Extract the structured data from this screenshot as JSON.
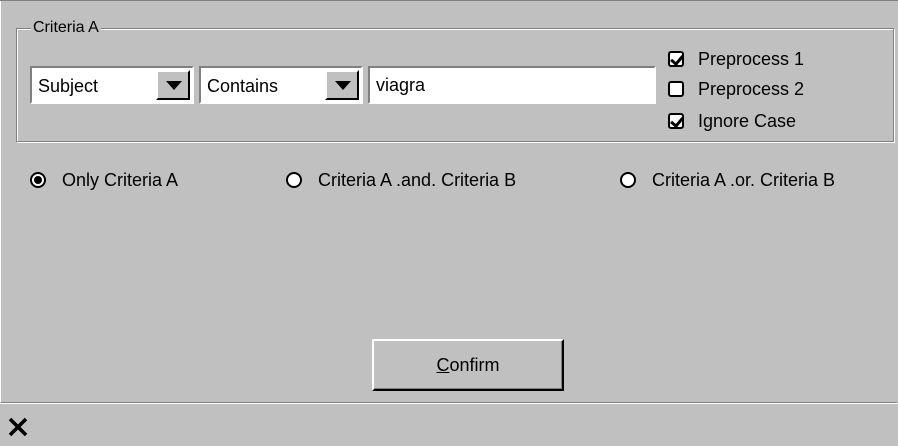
{
  "criteria_a": {
    "group_label": "Criteria A",
    "field_select": {
      "value": "Subject"
    },
    "operator_select": {
      "value": "Contains"
    },
    "search_text": "viagra",
    "options": [
      {
        "label": "Preprocess 1",
        "checked": true
      },
      {
        "label": "Preprocess 2",
        "checked": false
      },
      {
        "label": "Ignore Case",
        "checked": true
      }
    ]
  },
  "mode_radios": [
    {
      "label": "Only Criteria A",
      "selected": true
    },
    {
      "label": "Criteria A .and. Criteria B",
      "selected": false
    },
    {
      "label": "Criteria A .or. Criteria B",
      "selected": false
    }
  ],
  "confirm": {
    "accel": "C",
    "rest": "onfirm"
  },
  "statusbar": {
    "close_icon": "close-icon"
  }
}
